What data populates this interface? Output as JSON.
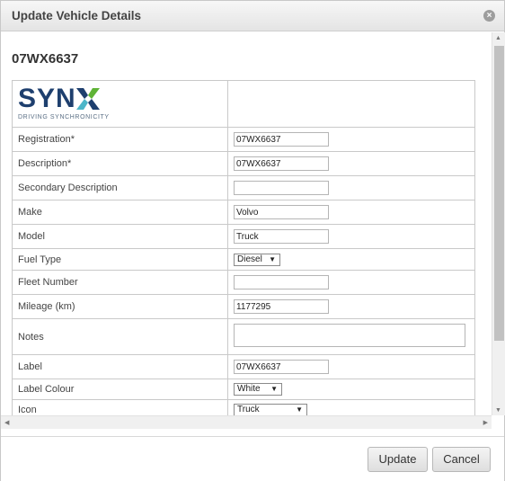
{
  "dialog": {
    "title": "Update Vehicle Details",
    "close_icon": "close-circle-icon"
  },
  "vehicle": {
    "heading": "07WX6637"
  },
  "logo": {
    "text": "SYNX",
    "tagline": "DRIVING SYNCHRONICITY",
    "color": "#1e3f6e",
    "accent": "#4cb6c9"
  },
  "form": {
    "registration": {
      "label": "Registration*",
      "value": "07WX6637"
    },
    "description": {
      "label": "Description*",
      "value": "07WX6637"
    },
    "secondary_description": {
      "label": "Secondary Description",
      "value": ""
    },
    "make": {
      "label": "Make",
      "value": "Volvo"
    },
    "model": {
      "label": "Model",
      "value": "Truck"
    },
    "fuel_type": {
      "label": "Fuel Type",
      "value": "Diesel"
    },
    "fleet_number": {
      "label": "Fleet Number",
      "value": ""
    },
    "mileage": {
      "label": "Mileage (km)",
      "value": "1177295"
    },
    "notes": {
      "label": "Notes",
      "value": ""
    },
    "label": {
      "label": "Label",
      "value": "07WX6637"
    },
    "label_colour": {
      "label": "Label Colour",
      "value": "White"
    },
    "icon": {
      "label": "Icon",
      "value": "Truck"
    }
  },
  "buttons": {
    "update": "Update",
    "cancel": "Cancel"
  }
}
